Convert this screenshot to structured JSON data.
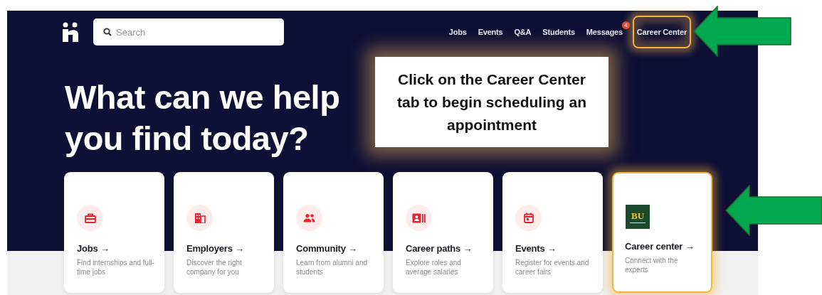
{
  "header": {
    "search": {
      "placeholder": "Search"
    },
    "nav": [
      {
        "label": "Jobs",
        "highlighted": false
      },
      {
        "label": "Events",
        "highlighted": false
      },
      {
        "label": "Q&A",
        "highlighted": false
      },
      {
        "label": "Students",
        "highlighted": false
      },
      {
        "label": "Messages",
        "highlighted": false,
        "badge": "4"
      },
      {
        "label": "Career Center",
        "highlighted": true
      }
    ]
  },
  "hero": {
    "title_lines": [
      "What can we help",
      "you find today?"
    ]
  },
  "callout": {
    "text": "Click on the Career Center tab to begin scheduling an appointment"
  },
  "cards": [
    {
      "kind": "briefcase",
      "title": "Jobs →",
      "description": "Find internships and full-time jobs",
      "highlighted": false
    },
    {
      "kind": "building",
      "title": "Employers →",
      "description": "Discover the right company for you",
      "highlighted": false
    },
    {
      "kind": "people",
      "title": "Community →",
      "description": "Learn from alumni and students",
      "highlighted": false
    },
    {
      "kind": "profile",
      "title": "Career paths →",
      "description": "Explore roles and average salaries",
      "highlighted": false
    },
    {
      "kind": "calendar",
      "title": "Events →",
      "description": "Register for events and career fairs",
      "highlighted": false
    },
    {
      "kind": "logo",
      "logo_text": "BU",
      "title": "Career center →",
      "description": "Connect with the experts",
      "highlighted": true
    }
  ]
}
